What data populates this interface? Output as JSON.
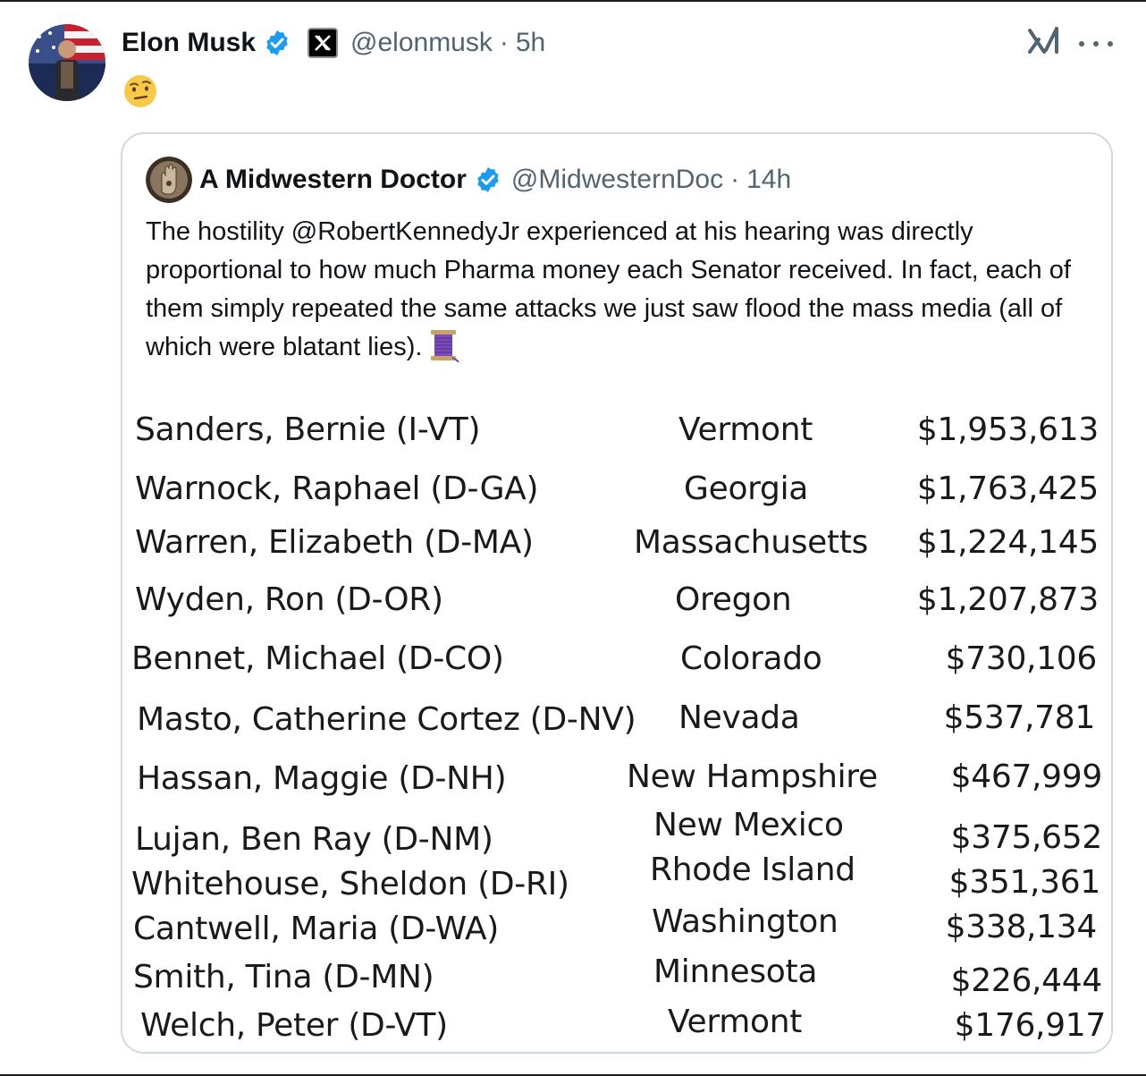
{
  "post": {
    "display_name": "Elon Musk",
    "handle": "@elonmusk",
    "separator": "·",
    "time": "5h",
    "icons": {
      "verified": "verified-badge-icon",
      "affiliation": "x-logo-badge",
      "grok": "grok-icon",
      "more": "more-options-icon",
      "emoji": "face-with-raised-eyebrow-emoji"
    },
    "colors": {
      "verified": "#1d9bf0",
      "secondary_text": "#536471",
      "border": "#cfd9de"
    }
  },
  "quote": {
    "display_name": "A Midwestern Doctor",
    "handle": "@MidwesternDoc",
    "separator": "·",
    "time": "14h",
    "text": "The hostility @RobertKennedyJr experienced at his hearing was directly proportional to how much Pharma money each Senator received. In fact, each of them simply repeated the same attacks we just saw flood the mass media (all of which were blatant lies).",
    "text_emoji": "thread-spool-emoji"
  },
  "table": {
    "rows": [
      {
        "senator": "Sanders, Bernie (I-VT)",
        "state": "Vermont",
        "amount": "$1,953,613"
      },
      {
        "senator": "Warnock, Raphael (D-GA)",
        "state": "Georgia",
        "amount": "$1,763,425"
      },
      {
        "senator": "Warren, Elizabeth (D-MA)",
        "state": "Massachusetts",
        "amount": "$1,224,145"
      },
      {
        "senator": "Wyden, Ron (D-OR)",
        "state": "Oregon",
        "amount": "$1,207,873"
      },
      {
        "senator": "Bennet, Michael (D-CO)",
        "state": "Colorado",
        "amount": "$730,106"
      },
      {
        "senator": "Masto, Catherine Cortez (D-NV)",
        "state": "Nevada",
        "amount": "$537,781"
      },
      {
        "senator": "Hassan, Maggie (D-NH)",
        "state": "New Hampshire",
        "amount": "$467,999"
      },
      {
        "senator": "Lujan, Ben Ray (D-NM)",
        "state": "New Mexico",
        "amount": "$375,652"
      },
      {
        "senator": "Whitehouse, Sheldon (D-RI)",
        "state": "Rhode Island",
        "amount": "$351,361"
      },
      {
        "senator": "Cantwell, Maria (D-WA)",
        "state": "Washington",
        "amount": "$338,134"
      },
      {
        "senator": "Smith, Tina (D-MN)",
        "state": "Minnesota",
        "amount": "$226,444"
      },
      {
        "senator": "Welch, Peter (D-VT)",
        "state": "Vermont",
        "amount": "$176,917"
      }
    ]
  }
}
